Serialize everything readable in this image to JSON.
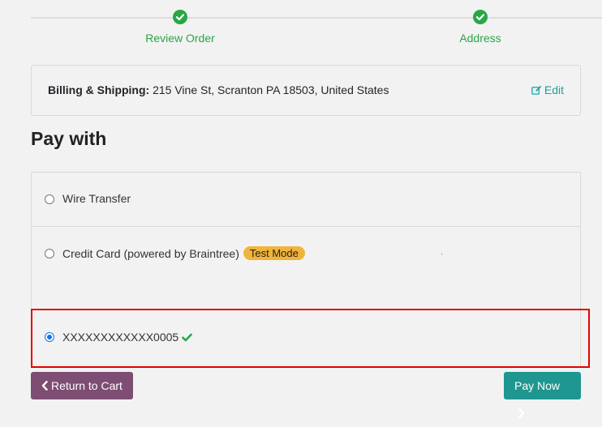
{
  "progress": {
    "steps": [
      {
        "label": "Review Order",
        "state": "complete"
      },
      {
        "label": "Address",
        "state": "complete"
      }
    ]
  },
  "address": {
    "label": "Billing & Shipping:",
    "value": "215 Vine St, Scranton PA 18503, United States",
    "edit_label": "Edit"
  },
  "payment": {
    "heading": "Pay with",
    "options": [
      {
        "label": "Wire Transfer",
        "selected": false
      },
      {
        "label": "Credit Card (powered by Braintree)",
        "badge": "Test Mode",
        "selected": false
      },
      {
        "label": "XXXXXXXXXXXX0005",
        "selected": true,
        "icon": "check-icon"
      }
    ]
  },
  "actions": {
    "return_label": "Return to Cart",
    "pay_label": "Pay Now"
  },
  "colors": {
    "success": "#28a745",
    "link": "#1ba1a1",
    "return_button": "#7d4d73",
    "pay_button": "#1f9690",
    "badge": "#f0b43b",
    "highlight": "#e30000"
  }
}
